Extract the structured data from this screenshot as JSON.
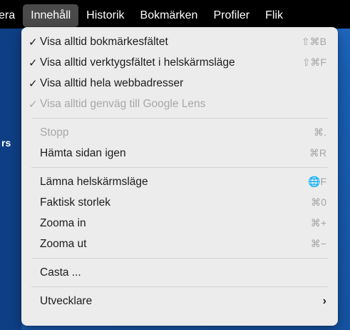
{
  "menubar": {
    "items": [
      {
        "label": "era"
      },
      {
        "label": "Innehåll"
      },
      {
        "label": "Historik"
      },
      {
        "label": "Bokmärken"
      },
      {
        "label": "Profiler"
      },
      {
        "label": "Flik"
      }
    ]
  },
  "menu": {
    "items": [
      {
        "label": "Visa alltid bokmärkesfältet",
        "checked": "✓",
        "shortcut": "⇧⌘B"
      },
      {
        "label": "Visa alltid verktygsfältet i helskärmsläge",
        "checked": "✓",
        "shortcut": "⇧⌘F"
      },
      {
        "label": "Visa alltid hela webbadresser",
        "checked": "✓",
        "shortcut": ""
      },
      {
        "label": "Visa alltid genväg till Google Lens",
        "checked": "✓",
        "shortcut": ""
      },
      {
        "label": "Stopp",
        "shortcut": "⌘."
      },
      {
        "label": "Hämta sidan igen",
        "shortcut": "⌘R"
      },
      {
        "label": "Lämna helskärmsläge",
        "shortcut": "🌐F"
      },
      {
        "label": "Faktisk storlek",
        "shortcut": "⌘0"
      },
      {
        "label": "Zooma in",
        "shortcut": "⌘+"
      },
      {
        "label": "Zooma ut",
        "shortcut": "⌘−"
      },
      {
        "label": "Casta ...",
        "shortcut": ""
      },
      {
        "label": "Utvecklare",
        "submenu_arrow": "›"
      }
    ]
  },
  "backdrop": {
    "peek_text": "rs"
  },
  "colors": {
    "menubar_bg": "#000000",
    "menu_bg": "#ececec",
    "active_menubar_item": "#4a4a4a",
    "disabled_text": "#a8a8a8",
    "page_bg": "#1d63b8"
  }
}
